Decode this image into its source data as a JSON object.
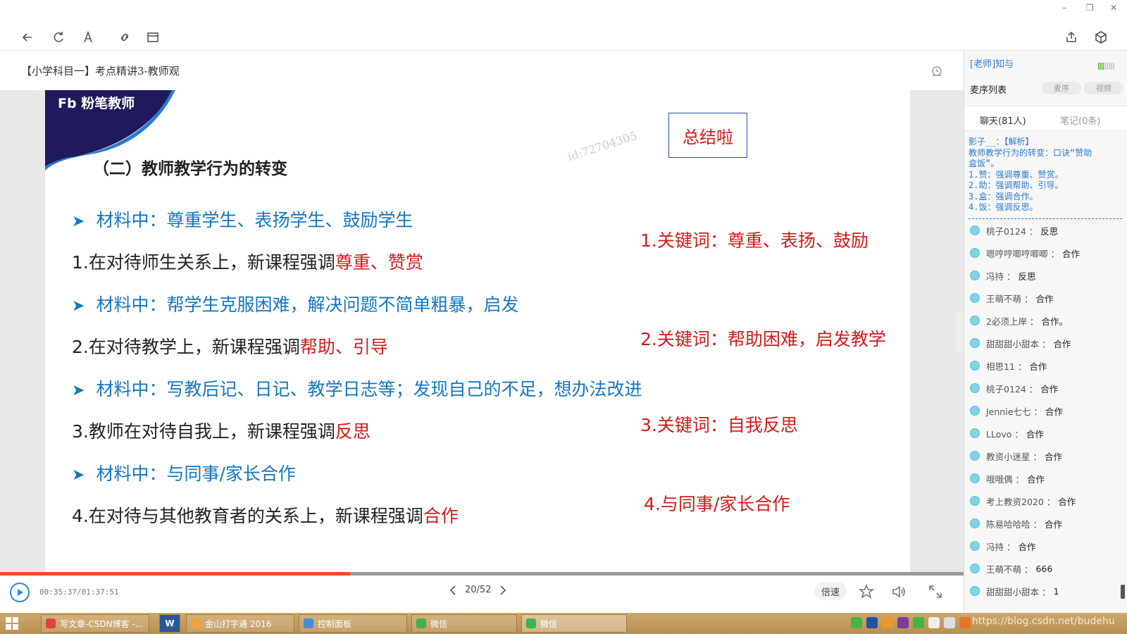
{
  "window": {
    "minimize": "–",
    "restore": "❐",
    "close": "✕"
  },
  "course": {
    "title": "【小学科目一】考点精讲3-教师观"
  },
  "slide": {
    "brand": "Fb 粉笔教师",
    "summary": "总结啦",
    "watermark": "id:72704305",
    "section_title": "（二）教师教学行为的转变",
    "bullets": [
      "材料中：尊重学生、表扬学生、鼓励学生",
      "材料中：帮学生克服困难，解决问题不简单粗暴，启发",
      "材料中：写教后记、日记、教学日志等；发现自己的不足，想办法改进",
      "材料中：与同事/家长合作"
    ],
    "points": [
      {
        "prefix": "1.在对待师生关系上，新课程强调",
        "emph": "尊重、赞赏"
      },
      {
        "prefix": "2.在对待教学上，新课程强调",
        "emph": "帮助、引导"
      },
      {
        "prefix": "3.教师在对待自我上，新课程强调",
        "emph": "反思"
      },
      {
        "prefix": "4.在对待与其他教育者的关系上，新课程强调",
        "emph": "合作"
      }
    ],
    "keywords": [
      "1.关键词：尊重、表扬、鼓励",
      "2.关键词：帮助困难，启发教学",
      "3.关键词：自我反思",
      "4.与同事/家长合作"
    ]
  },
  "player": {
    "progress": 0.3635,
    "time": "00:35:37/01:37:51",
    "page": "20/52",
    "speed_label": "倍速"
  },
  "panel": {
    "header": "[老师]知与",
    "mic_list": "麦序列表",
    "mic_pill": "麦序",
    "video_pill": "视频",
    "chat_tab": "聊天(81人)",
    "notes_tab": "笔记(0条)",
    "pinned": [
      "影子__：【解析】",
      "教师教学行为的转变：口诀“赞助",
      "盒饭”。",
      "1.赞：强调尊重、赞赏。",
      "2.助：强调帮助、引导。",
      "3.盒：强调合作。",
      "4.饭：强调反思。"
    ],
    "messages": [
      {
        "user": "桃子0124 ：",
        "text": "反思"
      },
      {
        "user": "嗯哼哼唧哼唧唧 ：",
        "text": "合作"
      },
      {
        "user": "冯持 ：",
        "text": "反思"
      },
      {
        "user": "王萌不萌 ：",
        "text": "合作"
      },
      {
        "user": "2必须上岸 ：",
        "text": "合作。"
      },
      {
        "user": "甜甜甜小甜本 ：",
        "text": "合作"
      },
      {
        "user": "相思11 ：",
        "text": "合作"
      },
      {
        "user": "桃子0124 ：",
        "text": "合作"
      },
      {
        "user": "Jennie七七 ：",
        "text": "合作"
      },
      {
        "user": "LLovo ：",
        "text": "合作"
      },
      {
        "user": "教资小迷星 ：",
        "text": "合作"
      },
      {
        "user": "哦哦偶 ：",
        "text": "合作"
      },
      {
        "user": "考上教资2020 ：",
        "text": "合作"
      },
      {
        "user": "陈易哈哈哈 ：",
        "text": "合作"
      },
      {
        "user": "冯持 ：",
        "text": "合作"
      },
      {
        "user": "王萌不萌 ：",
        "text": "666"
      },
      {
        "user": "甜甜甜小甜本 ：",
        "text": "1"
      }
    ]
  },
  "taskbar": {
    "items": [
      "写文章-CSDN博客 -...",
      "W",
      "金山打字通 2016",
      "控制面板",
      "微信",
      "微信"
    ],
    "watermark": "https://blog.csdn.net/budehu"
  },
  "colors": {
    "accent": "#1377c2",
    "emphasis": "#d31a1a",
    "progress": "#ef4d23",
    "chat_blue": "#2b7bd0"
  }
}
